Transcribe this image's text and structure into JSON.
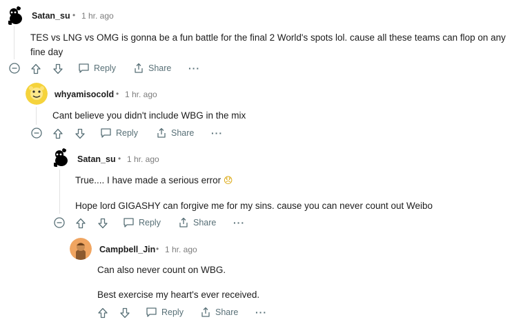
{
  "comments": [
    {
      "author": "Satan_su",
      "separator": "•",
      "time": "1 hr. ago",
      "body": [
        "TES vs LNG vs OMG is gonna be a fun battle for the final 2 World's spots lol. cause all these teams can flop on any fine day"
      ],
      "avatar_color": "#000000"
    },
    {
      "author": "whyamisocold",
      "separator": "•",
      "time": "1 hr. ago",
      "body": [
        "Cant believe you didn't include WBG in the mix"
      ],
      "avatar_color": "#f5d33c"
    },
    {
      "author": "Satan_su",
      "separator": "•",
      "time": "1 hr. ago",
      "body": [
        "True.... I have made a serious error",
        "Hope lord GIGASHY can forgive me for my sins. cause you can never count out Weibo"
      ],
      "emoji": "😞",
      "avatar_color": "#000000"
    },
    {
      "author": "Campbell_Jin",
      "separator": "•",
      "time": "1 hr. ago",
      "body": [
        "Can also never count on WBG.",
        "Best exercise my heart's ever received."
      ],
      "avatar_color": "#f0a561"
    }
  ],
  "actions": {
    "reply_label": "Reply",
    "share_label": "Share",
    "more_label": "···"
  },
  "colors": {
    "action_text": "#576f76",
    "meta_text": "#7c7c7c",
    "thread_line": "#e2e2e2"
  }
}
